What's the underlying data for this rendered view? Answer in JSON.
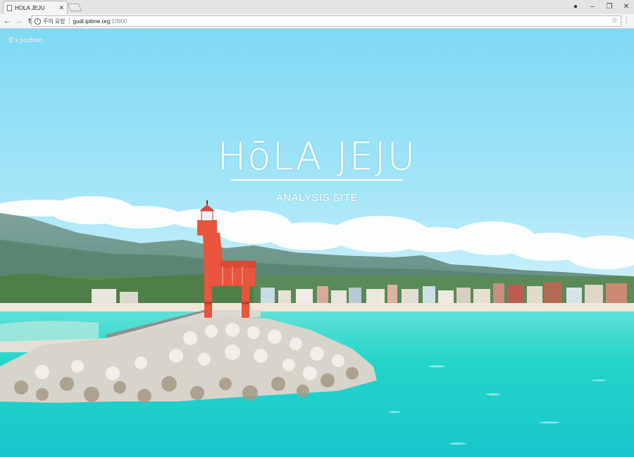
{
  "browser": {
    "tab_title": "HOLA JEJU",
    "security_label": "주의 요함",
    "url_host": "gudi.iptime.org",
    "url_port": ":10900",
    "colors": {
      "chrome": "#f5f5f5",
      "tabbar": "#e4e4e4"
    },
    "icons": [
      "document-icon",
      "close-icon",
      "new-tab-icon",
      "account-icon",
      "minimize-icon",
      "restore-icon",
      "window-close-icon",
      "back-icon",
      "forward-icon",
      "reload-icon",
      "info-icon",
      "bookmark-star-icon",
      "menu-icon"
    ]
  },
  "page": {
    "brand": "경's portfolio",
    "hero_title": "HōLA JEJU",
    "hero_subtitle": "ANALYSIS SITE",
    "background": "Jeju coastline with red horse-shaped lighthouse on breakwater, turquoise sea, town, mountains and clouds",
    "colors": {
      "sky": "#7fd8f2",
      "sea": "#1fd5c8",
      "lighthouse": "#e8553c",
      "text": "#ffffff"
    }
  }
}
